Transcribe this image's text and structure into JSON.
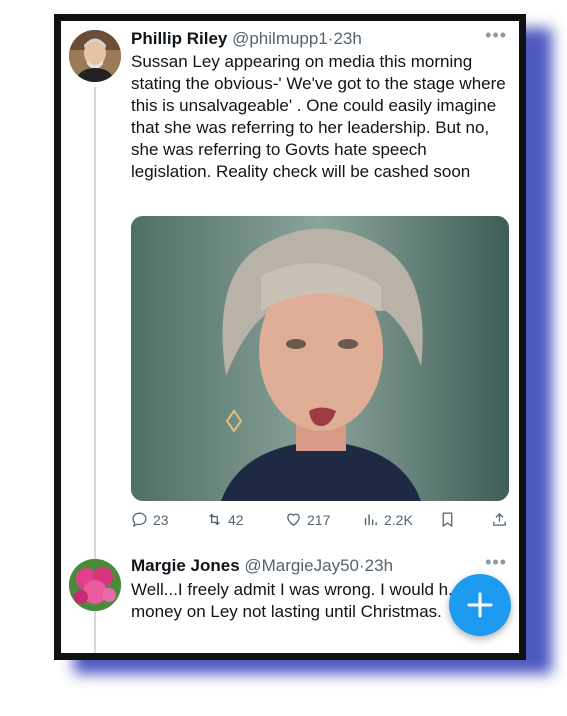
{
  "tweets": [
    {
      "name": "Phillip Riley",
      "handle": "@philmupp1",
      "time": "23h",
      "text": "Sussan Ley appearing on media this morning stating the obvious-' We've got to the stage where this is unsalvageable' . One could easily imagine that she was referring to her leadership. But no, she was referring to  Govts hate speech legislation. Reality check will be cashed soon",
      "actions": {
        "replies": "23",
        "retweets": "42",
        "likes": "217",
        "views": "2.2K"
      }
    },
    {
      "name": "Margie Jones",
      "handle": "@MargieJay50",
      "time": "23h",
      "text": "Well...I freely admit I was wrong. I would h... put money on Ley not lasting until Christmas."
    }
  ],
  "separator": "·",
  "more_glyph": "•••",
  "icons": [
    "reply-icon",
    "retweet-icon",
    "like-icon",
    "views-icon",
    "bookmark-icon",
    "share-icon",
    "compose-plus-icon"
  ],
  "colors": {
    "accent": "#1d9bf0",
    "frame": "#111111",
    "shadow": "#3a46b8",
    "meta": "#536471"
  }
}
